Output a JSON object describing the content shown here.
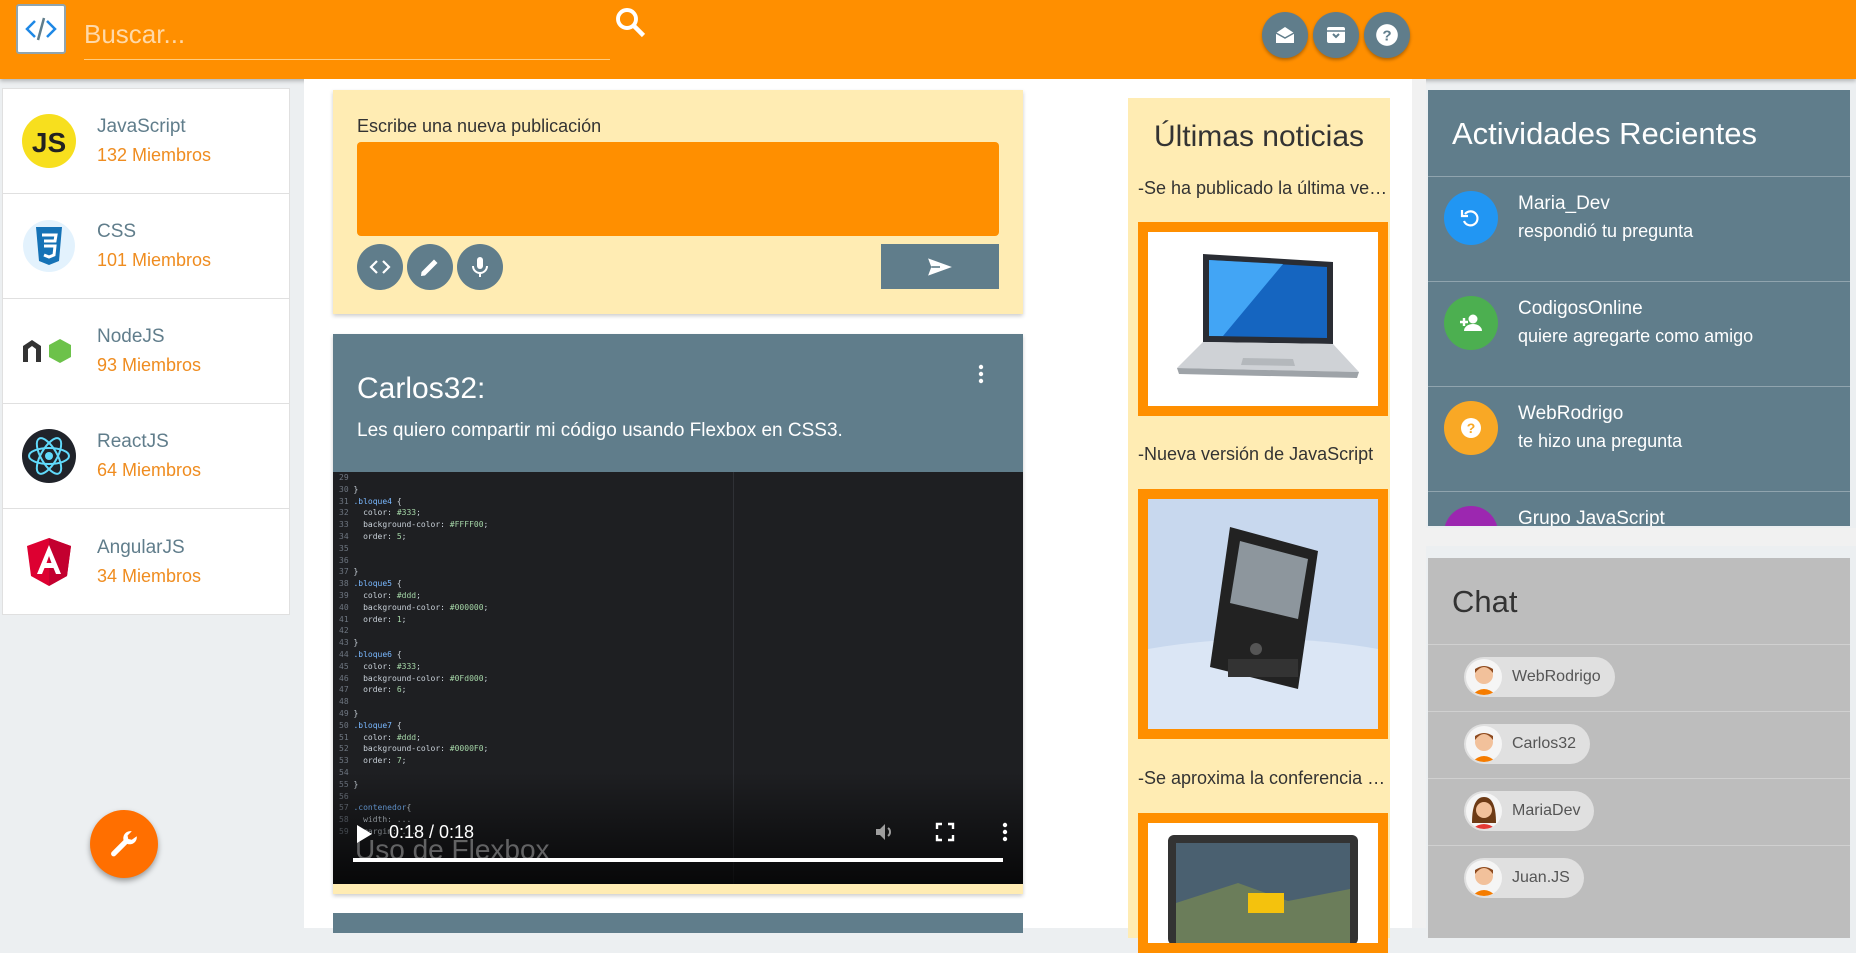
{
  "header": {
    "search_placeholder": "Buscar...",
    "accent": "#ff8f00"
  },
  "groups": [
    {
      "name": "JavaScript",
      "members": "132 Miembros",
      "icon": "javascript-logo"
    },
    {
      "name": "CSS",
      "members": "101 Miembros",
      "icon": "css3-logo"
    },
    {
      "name": "NodeJS",
      "members": "93 Miembros",
      "icon": "nodejs-logo"
    },
    {
      "name": "ReactJS",
      "members": "64 Miembros",
      "icon": "react-logo"
    },
    {
      "name": "AngularJS",
      "members": "34 Miembros",
      "icon": "angular-logo"
    }
  ],
  "compose": {
    "label": "Escribe una nueva publicación"
  },
  "post": {
    "author": "Carlos32:",
    "text": "Les quiero compartir mi código usando Flexbox en CSS3.",
    "video_title": "Uso de Flexbox",
    "video_time": "0:18 / 0:18",
    "video_progress": 1.0
  },
  "news": {
    "title": "Últimas noticias",
    "items": [
      "-Se ha publicado la última versión de Laptop",
      "-Nueva versión de JavaScript",
      "-Se aproxima la conferencia de videojuegos"
    ]
  },
  "activity": {
    "title": "Actividades Recientes",
    "items": [
      {
        "name": "Maria_Dev",
        "desc": "respondió tu pregunta",
        "color": "#2196f3"
      },
      {
        "name": "CodigosOnline",
        "desc": "quiere agregarte como amigo",
        "color": "#4caf50"
      },
      {
        "name": "WebRodrigo",
        "desc": "te hizo una pregunta",
        "color": "#f9a825"
      },
      {
        "name": "Grupo JavaScript",
        "desc": "",
        "color": "#9c27b0"
      }
    ]
  },
  "chat": {
    "title": "Chat",
    "users": [
      "WebRodrigo",
      "Carlos32",
      "MariaDev",
      "Juan.JS"
    ]
  }
}
